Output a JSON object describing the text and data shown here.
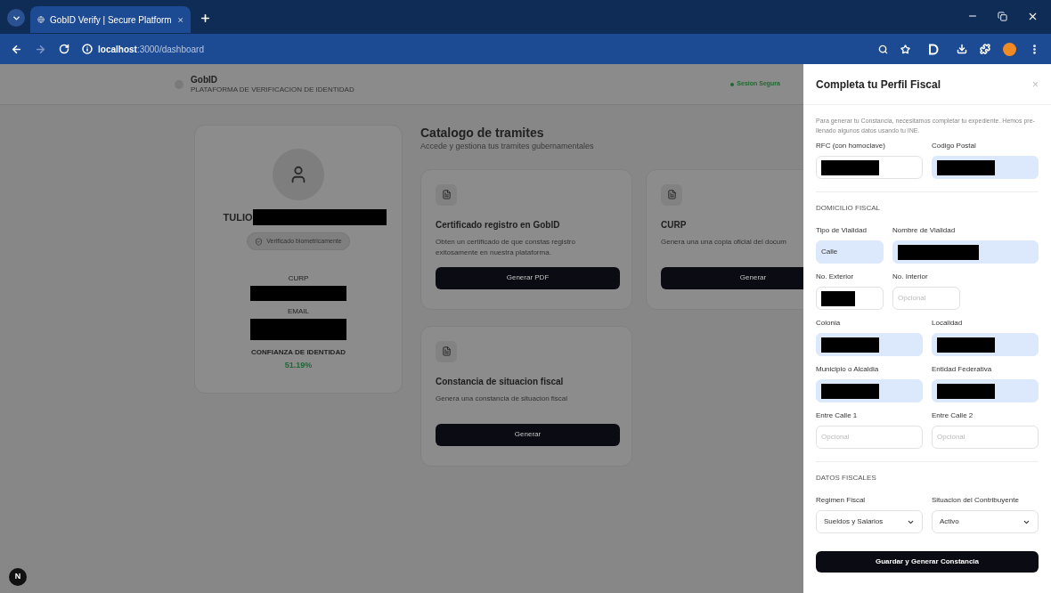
{
  "browser": {
    "tab": {
      "title": "GobID Verify | Secure Platform",
      "selected": true
    },
    "url": {
      "host": "localhost",
      "path": ":3000/dashboard"
    }
  },
  "header": {
    "brand": "GobID",
    "tagline": "PLATAFORMA DE VERIFICACION DE IDENTIDAD",
    "session": "Sesion Segura"
  },
  "profile": {
    "name": "TULIO",
    "name_redacted": true,
    "badge": "Verificado biometricamente",
    "fields": [
      {
        "label": "CURP",
        "redacted": true
      },
      {
        "label": "EMAIL",
        "redacted": true
      }
    ],
    "confidence_label": "CONFIANZA DE IDENTIDAD",
    "confidence": "51.19%"
  },
  "catalog": {
    "title": "Catalogo de tramites",
    "subtitle": "Accede y gestiona tus tramites gubernamentales",
    "cards": [
      {
        "title": "Certificado registro en GobID",
        "description": "Obten un certificado de que constas registro exitosamente en nuestra plataforma.",
        "button": "Generar PDF"
      },
      {
        "title": "CURP",
        "description": "Genera una una copia oficial del docum",
        "button": "Generar"
      },
      {
        "title": "Constancia de situacion fiscal",
        "description": "Genera una constancia de situacion fiscal",
        "button": "Generar"
      }
    ]
  },
  "dev_badge": "N",
  "panel": {
    "title": "Completa tu Perfil Fiscal",
    "close": "×",
    "intro": "Para generar tu Constancia, necesitamos completar tu expediente. Hemos pre-llenado algunos datos usando tu INE.",
    "sections": [
      {
        "rows": [
          [
            {
              "kind": "input",
              "label": "RFC (con homoclave)",
              "redacted": true,
              "prefilled": false
            },
            {
              "kind": "input",
              "label": "Codigo Postal",
              "redacted": true,
              "prefilled": true
            }
          ]
        ]
      },
      {
        "title": "DOMICILIO FISCAL",
        "rows": [
          [
            {
              "kind": "input",
              "label": "Tipo de Vialidad",
              "value": "Calle",
              "prefilled": true
            },
            {
              "kind": "input",
              "label": "Nombre de Vialidad",
              "redacted": true,
              "prefilled": true
            }
          ],
          [
            {
              "kind": "input",
              "label": "No. Exterior",
              "redacted": true,
              "prefilled": false
            },
            {
              "kind": "input",
              "label": "No. Interior",
              "placeholder": "Opcional",
              "prefilled": false
            }
          ],
          [
            {
              "kind": "input",
              "label": "Colonia",
              "redacted": true,
              "prefilled": true
            },
            {
              "kind": "input",
              "label": "Localidad",
              "redacted": true,
              "prefilled": true
            }
          ],
          [
            {
              "kind": "input",
              "label": "Municipio o Alcaldia",
              "redacted": true,
              "prefilled": true
            },
            {
              "kind": "input",
              "label": "Entidad Federativa",
              "redacted": true,
              "prefilled": true
            }
          ],
          [
            {
              "kind": "input",
              "label": "Entre Calle 1",
              "placeholder": "Opcional",
              "prefilled": false
            },
            {
              "kind": "input",
              "label": "Entre Calle 2",
              "placeholder": "Opcional",
              "prefilled": false
            }
          ]
        ]
      },
      {
        "title": "DATOS FISCALES",
        "rows": [
          [
            {
              "kind": "select",
              "label": "Regimen Fiscal",
              "value": "Sueldos y Salarios",
              "prefilled": false
            },
            {
              "kind": "select",
              "label": "Situacion del Contribuyente",
              "value": "Activo",
              "prefilled": false
            }
          ]
        ]
      }
    ],
    "submit": "Guardar y Generar Constancia"
  }
}
